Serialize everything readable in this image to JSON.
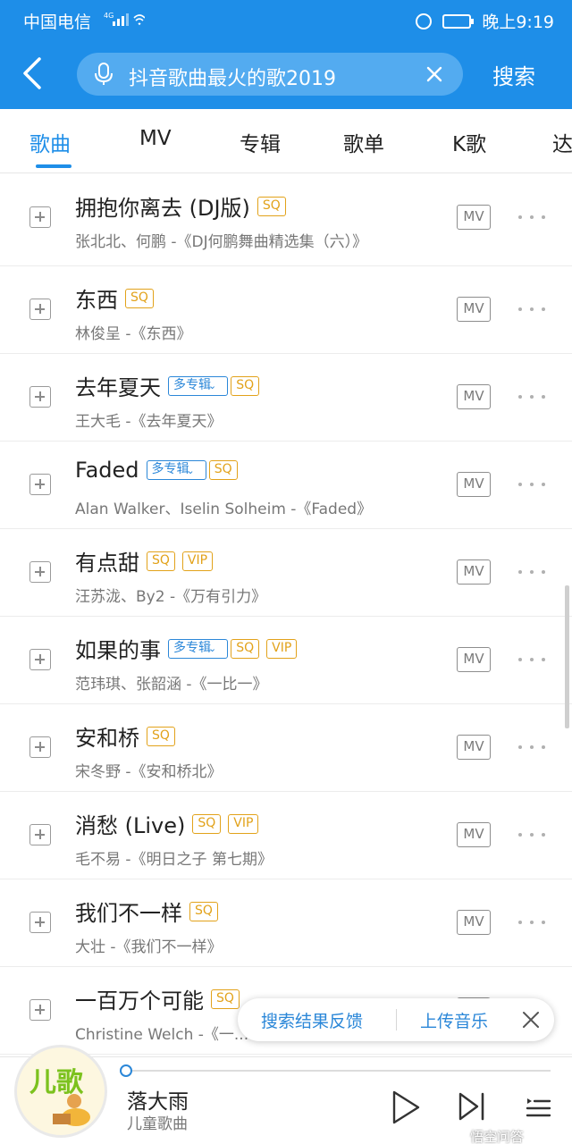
{
  "status_bar": {
    "carrier": "中国电信",
    "network": "4G",
    "time": "晚上9:19",
    "battery_level": 0.85
  },
  "search": {
    "query": "抖音歌曲最火的歌2019",
    "submit_label": "搜索"
  },
  "tabs": [
    {
      "label": "歌曲",
      "active": true
    },
    {
      "label": "MV",
      "active": false
    },
    {
      "label": "专辑",
      "active": false
    },
    {
      "label": "歌单",
      "active": false
    },
    {
      "label": "K歌",
      "active": false
    },
    {
      "label": "达",
      "active": false
    }
  ],
  "songs": [
    {
      "title": "拥抱你离去 (DJ版)",
      "tags": [
        "SQ"
      ],
      "subtitle": "张北北、何鹏 -《DJ何鹏舞曲精选集（六）》",
      "mv": "MV"
    },
    {
      "title": "东西",
      "tags": [
        "SQ"
      ],
      "subtitle": "林俊呈 -《东西》",
      "mv": "MV"
    },
    {
      "title": "去年夏天",
      "tags": [
        "多专辑",
        "SQ"
      ],
      "subtitle": "王大毛 -《去年夏天》",
      "mv": "MV"
    },
    {
      "title": "Faded",
      "tags": [
        "多专辑",
        "SQ"
      ],
      "subtitle": "Alan Walker、Iselin Solheim -《Faded》",
      "mv": "MV"
    },
    {
      "title": "有点甜",
      "tags": [
        "SQ",
        "VIP"
      ],
      "subtitle": "汪苏泷、By2 -《万有引力》",
      "mv": "MV"
    },
    {
      "title": "如果的事",
      "tags": [
        "多专辑",
        "SQ",
        "VIP"
      ],
      "subtitle": "范玮琪、张韶涵 -《一比一》",
      "mv": "MV"
    },
    {
      "title": "安和桥",
      "tags": [
        "SQ"
      ],
      "subtitle": "宋冬野 -《安和桥北》",
      "mv": "MV"
    },
    {
      "title": "消愁 (Live)",
      "tags": [
        "SQ",
        "VIP"
      ],
      "subtitle": "毛不易 -《明日之子 第七期》",
      "mv": "MV"
    },
    {
      "title": "我们不一样",
      "tags": [
        "SQ"
      ],
      "subtitle": "大壮 -《我们不一样》",
      "mv": "MV"
    },
    {
      "title": "一百万个可能",
      "tags": [
        "SQ"
      ],
      "subtitle": "Christine Welch -《一...",
      "mv": "MV"
    }
  ],
  "feedback": {
    "feedback_label": "搜索结果反馈",
    "upload_label": "上传音乐"
  },
  "player": {
    "title": "落大雨",
    "artist": "儿童歌曲",
    "cover_text": "儿歌",
    "progress": 0.0
  },
  "watermark": "悟空问答",
  "colors": {
    "brand": "#1e8ee8",
    "sq": "#e2a21a",
    "multi_album": "#2b87d8"
  }
}
